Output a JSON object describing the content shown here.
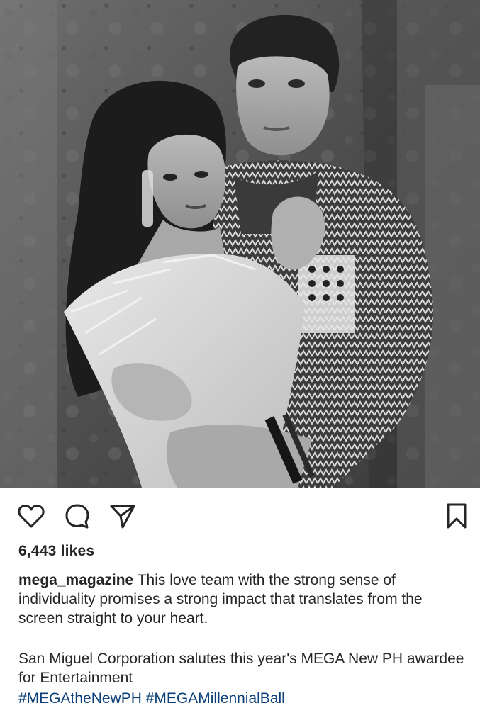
{
  "post": {
    "image_alt": "Black and white editorial photo of a couple posing against a stone wall",
    "likes_text": "6,443 likes",
    "username": "mega_magazine",
    "caption_text": " This love team with the strong sense of individuality promises a strong impact that translates from the screen straight to your heart.",
    "caption_second": "San Miguel Corporation salutes this year's MEGA New PH awardee for Entertainment",
    "hashtags": [
      "#MEGAtheNewPH",
      "#MEGAMillennialBall"
    ]
  },
  "actions": {
    "like_icon": "heart-icon",
    "comment_icon": "comment-icon",
    "share_icon": "paper-plane-icon",
    "save_icon": "bookmark-icon"
  },
  "colors": {
    "text": "#262626",
    "hashtag": "#0b3f78",
    "background": "#ffffff"
  }
}
